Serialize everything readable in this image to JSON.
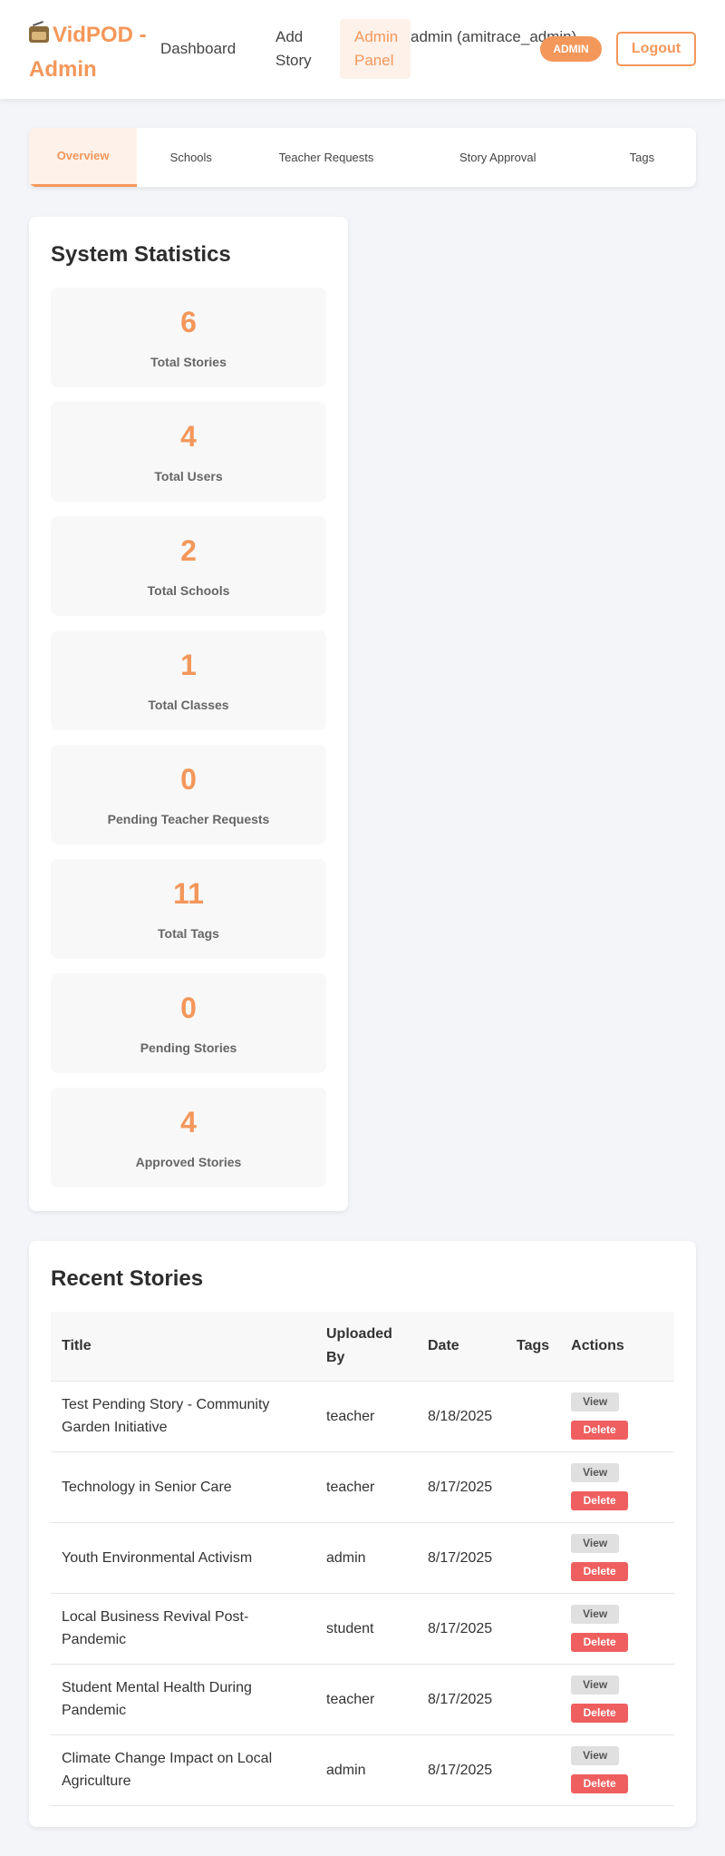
{
  "header": {
    "logo_text": "VidPOD - Admin",
    "nav": [
      "Dashboard",
      "Add Story",
      "Admin Panel"
    ],
    "user": "admin (amitrace_admin)",
    "badge": "ADMIN",
    "logout": "Logout"
  },
  "tabs": [
    "Overview",
    "Schools",
    "Teacher Requests",
    "Story Approval",
    "Tags"
  ],
  "stats": {
    "title": "System Statistics",
    "items": [
      {
        "value": "6",
        "label": "Total Stories"
      },
      {
        "value": "4",
        "label": "Total Users"
      },
      {
        "value": "2",
        "label": "Total Schools"
      },
      {
        "value": "1",
        "label": "Total Classes"
      },
      {
        "value": "0",
        "label": "Pending Teacher Requests"
      },
      {
        "value": "11",
        "label": "Total Tags"
      },
      {
        "value": "0",
        "label": "Pending Stories"
      },
      {
        "value": "4",
        "label": "Approved Stories"
      }
    ]
  },
  "recent": {
    "title": "Recent Stories",
    "columns": [
      "Title",
      "Uploaded By",
      "Date",
      "Tags",
      "Actions"
    ],
    "view_label": "View",
    "delete_label": "Delete",
    "rows": [
      {
        "title": "Test Pending Story - Community Garden Initiative",
        "by": "teacher",
        "date": "8/18/2025",
        "tags": ""
      },
      {
        "title": "Technology in Senior Care",
        "by": "teacher",
        "date": "8/17/2025",
        "tags": ""
      },
      {
        "title": "Youth Environmental Activism",
        "by": "admin",
        "date": "8/17/2025",
        "tags": ""
      },
      {
        "title": "Local Business Revival Post-Pandemic",
        "by": "student",
        "date": "8/17/2025",
        "tags": ""
      },
      {
        "title": "Student Mental Health During Pandemic",
        "by": "teacher",
        "date": "8/17/2025",
        "tags": ""
      },
      {
        "title": "Climate Change Impact on Local Agriculture",
        "by": "admin",
        "date": "8/17/2025",
        "tags": ""
      }
    ]
  }
}
